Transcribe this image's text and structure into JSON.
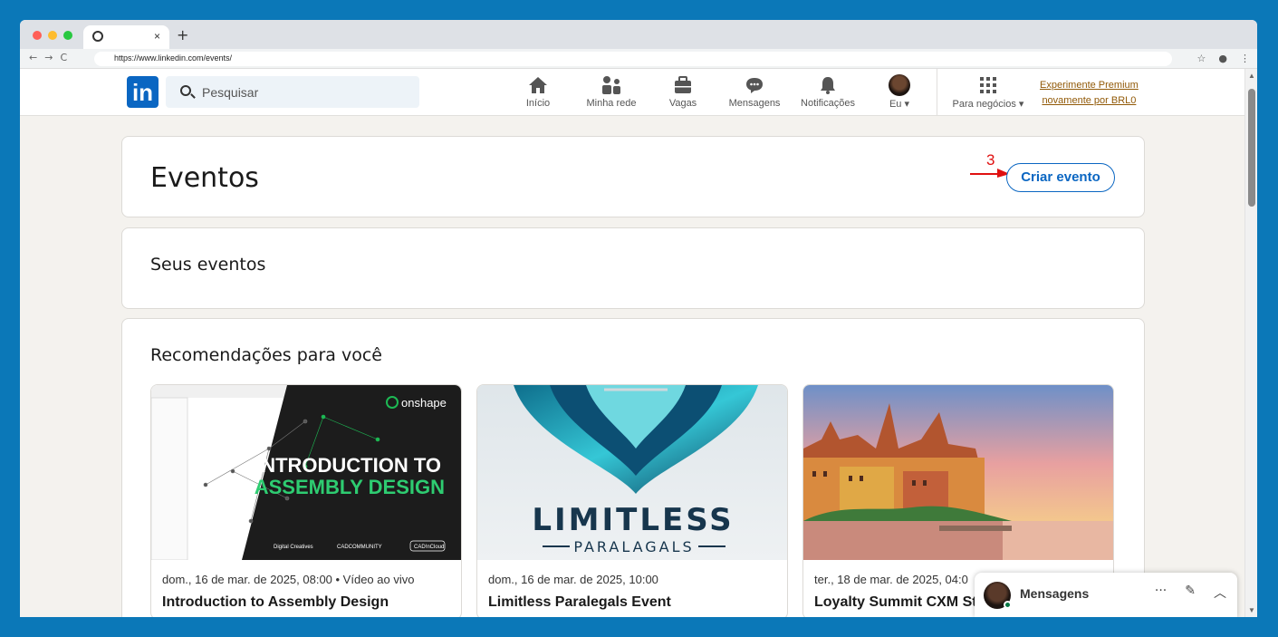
{
  "browser": {
    "tab_close": "×",
    "new_tab": "+",
    "url": "https://www.linkedin.com/events/"
  },
  "nav": {
    "search_placeholder": "Pesquisar",
    "items": [
      {
        "label": "Início",
        "icon": "home-icon"
      },
      {
        "label": "Minha rede",
        "icon": "network-icon"
      },
      {
        "label": "Vagas",
        "icon": "briefcase-icon"
      },
      {
        "label": "Mensagens",
        "icon": "messaging-icon"
      },
      {
        "label": "Notificações",
        "icon": "bell-icon"
      },
      {
        "label": "Eu",
        "icon": "avatar"
      },
      {
        "label": "Para negócios",
        "icon": "grid-icon"
      }
    ],
    "premium_line1": "Experimente Premium",
    "premium_line2": "novamente por BRL0"
  },
  "events_header": {
    "title": "Eventos",
    "create_button": "Criar evento",
    "annotation_number": "3",
    "annotation_color": "#e01010"
  },
  "your_events": {
    "title": "Seus eventos"
  },
  "recommendations": {
    "title": "Recomendações para você",
    "events": [
      {
        "date": "dom., 16 de mar. de 2025, 08:00  •  Vídeo ao vivo",
        "name": "Introduction to Assembly Design",
        "img_title_1": "INTRODUCTION TO",
        "img_title_2": "ASSEMBLY DESIGN",
        "img_brand": "onshape",
        "img_sponsors": [
          "Digital Creatives",
          "CADCOMMUNITY",
          "CAD!nCloud"
        ]
      },
      {
        "date": "dom., 16 de mar. de 2025, 10:00",
        "name": "Limitless Paralegals Event",
        "img_title_1": "LIMITLESS",
        "img_title_2": "PARALAGALS"
      },
      {
        "date": "ter., 18 de mar. de 2025, 04:0",
        "name": "Loyalty Summit CXM Sto"
      }
    ]
  },
  "messaging": {
    "title": "Mensagens",
    "actions": [
      "···",
      "compose-icon",
      "chevron-up-icon"
    ]
  },
  "colors": {
    "brand": "#0a66c2",
    "premium": "#915907",
    "background": "#f4f2ee"
  }
}
